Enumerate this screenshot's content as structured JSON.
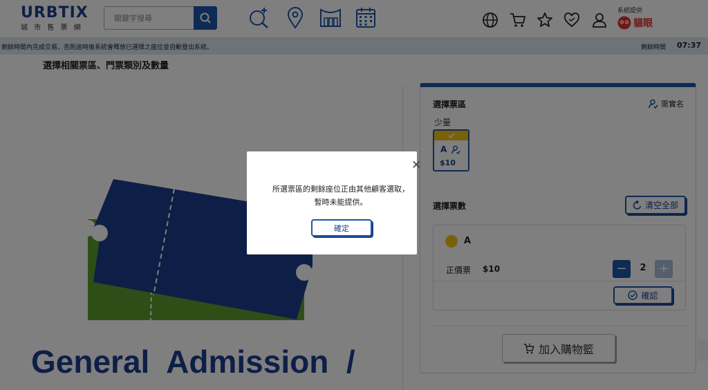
{
  "header": {
    "logo_text": "URBTIX",
    "logo_subtitle": "城 市 售 票 網",
    "search_placeholder": "關鍵字搜尋",
    "provider_label": "系統提供",
    "provider_name": "貓眼"
  },
  "timer_bar": {
    "message": "剩餘時間內完成交易，否則逾時後系統會釋放已選擇之座位並自動登出系統。",
    "label": "剩餘時間",
    "value": "07:37"
  },
  "main": {
    "section_title": "選擇相關票區、門票類別及數量",
    "event_title": "General  Admission  /"
  },
  "panel": {
    "zone_title": "選擇票區",
    "realname_label": "需實名",
    "tier_label": "少量",
    "zone_card": {
      "code": "A",
      "price": "$10"
    },
    "quantity_title": "選擇票數",
    "clear_label": "清空全部",
    "zone_name": "A",
    "ticket_type": "正價票",
    "ticket_price": "$10",
    "quantity": "2",
    "confirm_label": "確認",
    "cart_label": "加入購物籃"
  },
  "modal": {
    "message": "所選票區的剩餘座位正由其他顧客選取，暫時未能提供。",
    "ok_label": "確定"
  },
  "colors": {
    "brand_blue": "#1c56a6",
    "dark_blue": "#1c3f8f",
    "accent_red": "#d7261e",
    "zone_yellow": "#f3c316",
    "ticket_green": "#5a9e2f"
  }
}
